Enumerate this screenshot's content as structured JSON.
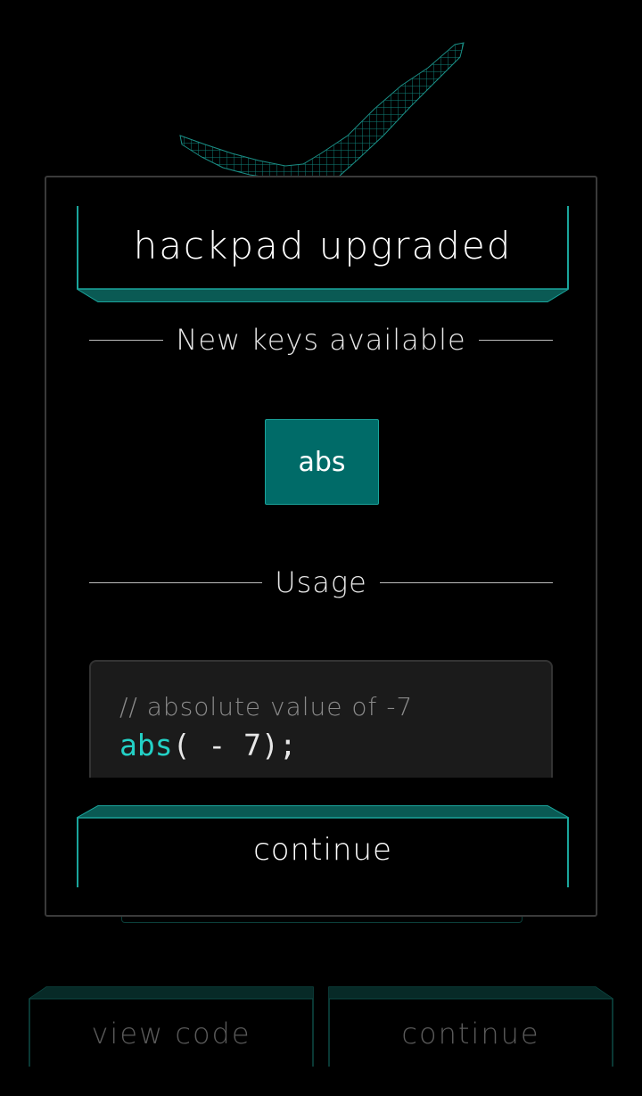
{
  "modal": {
    "title": "hackpad upgraded",
    "section_keys": "New keys available",
    "key_label": "abs",
    "section_usage": "Usage",
    "code_comment": "// absolute value of -7",
    "code_fn": "abs",
    "code_rest": "( - 7);",
    "continue_label": "continue"
  },
  "background": {
    "view_code_label": "view code",
    "continue_label": "continue"
  },
  "colors": {
    "accent": "#1aa59c",
    "key_fill": "#006b68",
    "code_fn": "#23d1c6"
  },
  "icons": {
    "decor": "grid-mesh-icon"
  }
}
